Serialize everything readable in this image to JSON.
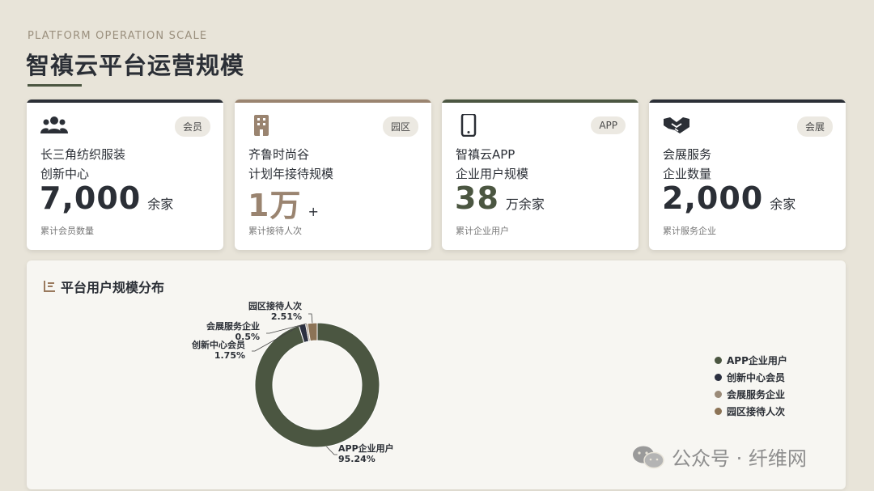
{
  "header": {
    "eyebrow": "PLATFORM OPERATION SCALE",
    "title": "智禛云平台运营规模"
  },
  "cards": [
    {
      "label1": "长三角纺织服装",
      "label2": "创新中心",
      "value": "7,000",
      "unit": "余家",
      "sub": "累计会员数量",
      "badge": "会员",
      "icon": "users-icon",
      "accent": "#2b2f36"
    },
    {
      "label1": "齐鲁时尚谷",
      "label2": "计划年接待规模",
      "value": "1万",
      "unit": "+",
      "sub": "累计接待人次",
      "badge": "园区",
      "icon": "building-icon",
      "accent": "#9a8470"
    },
    {
      "label1": "智禛云APP",
      "label2": "企业用户规模",
      "value": "38",
      "unit": "万余家",
      "sub": "累计企业用户",
      "badge": "APP",
      "icon": "mobile-icon",
      "accent": "#4b5641"
    },
    {
      "label1": "会展服务",
      "label2": "企业数量",
      "value": "2,000",
      "unit": "余家",
      "sub": "累计服务企业",
      "badge": "会展",
      "icon": "handshake-icon",
      "accent": "#2b2f36"
    }
  ],
  "panel": {
    "title": "平台用户规模分布",
    "title_icon": "chart-list-icon"
  },
  "chart_data": {
    "type": "pie",
    "donut": true,
    "title": "平台用户规模分布",
    "categories": [
      "APP企业用户",
      "创新中心会员",
      "会展服务企业",
      "园区接待人次"
    ],
    "values": [
      95.24,
      1.75,
      0.5,
      2.51
    ],
    "value_labels": [
      "95.24%",
      "1.75%",
      "0.5%",
      "2.51%"
    ],
    "colors": [
      "#4b5641",
      "#2b3040",
      "#9a8a78",
      "#8c7356"
    ],
    "legend_position": "right"
  },
  "watermark": {
    "text": "公众号 · 纤维网",
    "icon": "wechat-icon"
  }
}
